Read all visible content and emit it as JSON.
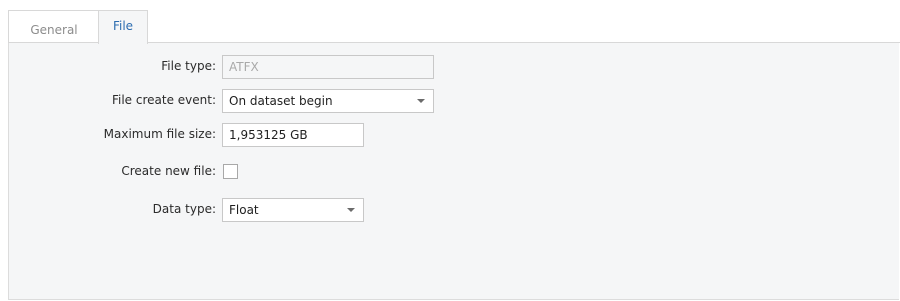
{
  "tabs": [
    {
      "label": "General",
      "active": false
    },
    {
      "label": "File",
      "active": true
    }
  ],
  "form": {
    "file_type": {
      "label": "File type:",
      "value": "ATFX"
    },
    "file_create_event": {
      "label": "File create event:",
      "value": "On dataset begin"
    },
    "max_file_size": {
      "label": "Maximum file size:",
      "value": "1,953125 GB"
    },
    "create_new_file": {
      "label": "Create new file:",
      "checked": false
    },
    "data_type": {
      "label": "Data type:",
      "value": "Float"
    }
  },
  "icons": {
    "dropdown_arrow": "chevron-down-icon"
  },
  "colors": {
    "active_tab_text": "#2b6cb0",
    "panel_background": "#f5f6f7",
    "border": "#c8c8c8"
  }
}
